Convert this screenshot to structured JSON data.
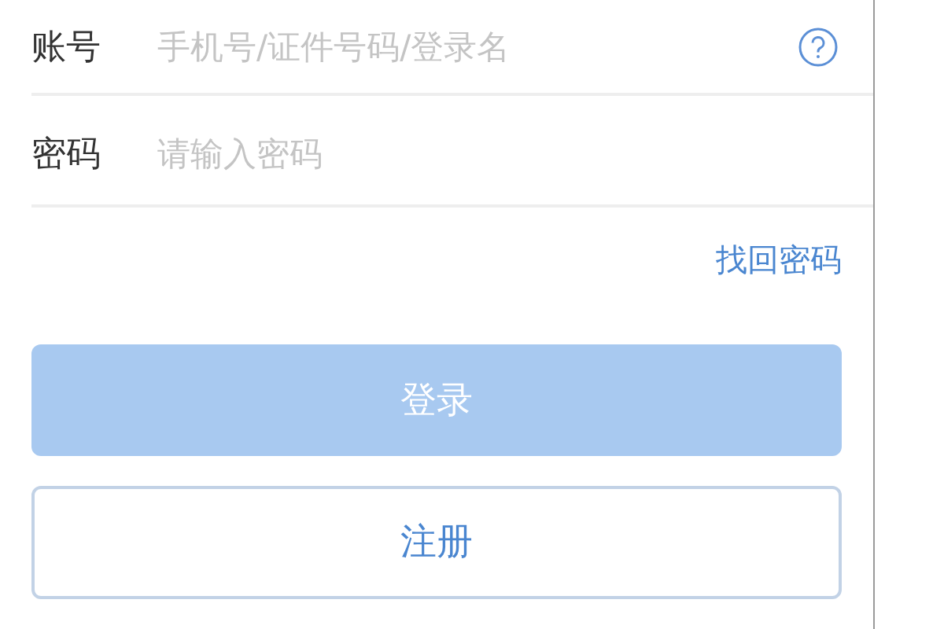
{
  "fields": [
    {
      "label": "账号",
      "placeholder": "手机号/证件号码/登录名",
      "help": true
    },
    {
      "label": "密码",
      "placeholder": "请输入密码",
      "help": false
    }
  ],
  "forgot_link": "找回密码",
  "buttons": [
    {
      "label": "登录",
      "kind": "primary",
      "disabled": true
    },
    {
      "label": "注册",
      "kind": "outline",
      "disabled": false
    }
  ]
}
